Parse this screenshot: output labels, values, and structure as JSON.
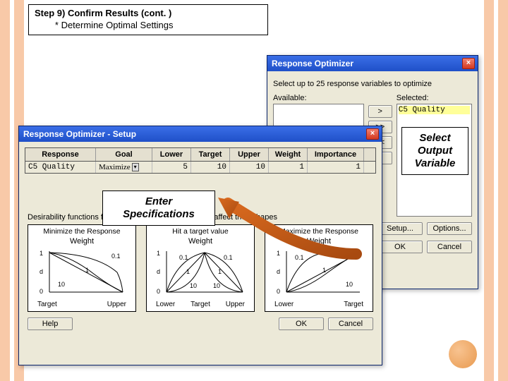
{
  "slide": {
    "title_line1": "Step 9) Confirm Results (cont. )",
    "title_line2": "        * Determine Optimal Settings"
  },
  "callouts": {
    "enter": "Enter Specifications",
    "select": "Select Output Variable"
  },
  "optimizer": {
    "title": "Response Optimizer",
    "hint": "Select up to 25 response variables to optimize",
    "available_label": "Available:",
    "selected_label": "Selected:",
    "selected_item": "C5   Quality",
    "move_right": ">",
    "move_all_right": ">>",
    "move_all_left": "<<",
    "move_left": "<",
    "setup_btn": "Setup...",
    "options_btn": "Options...",
    "ok_btn": "OK",
    "cancel_btn": "Cancel",
    "close_glyph": "×"
  },
  "setup": {
    "title": "Response Optimizer - Setup",
    "close_glyph": "×",
    "headers": {
      "response": "Response",
      "goal": "Goal",
      "lower": "Lower",
      "target": "Target",
      "upper": "Upper",
      "weight": "Weight",
      "importance": "Importance"
    },
    "row": {
      "response": "C5  Quality",
      "goal": "Maximize",
      "lower": "5",
      "target": "10",
      "upper": "10",
      "weight": "1",
      "importance": "1"
    },
    "desirability_label": "Desirability functions for different goals - how Weights affect their shapes",
    "plots": {
      "minimize": {
        "title": "Minimize the Response",
        "weight": "Weight",
        "x1": "Target",
        "x2": "Upper"
      },
      "target": {
        "title": "Hit a target value",
        "weight": "Weight",
        "x1": "Lower",
        "x2": "Target",
        "x3": "Upper"
      },
      "maximize": {
        "title": "Maximize the Response",
        "weight": "Weight",
        "x1": "Lower",
        "x2": "Target"
      }
    },
    "w_labels": {
      "a": "0.1",
      "b": "1",
      "c": "10"
    },
    "y_labels": {
      "top": "1",
      "mid": "d",
      "bot": "0"
    },
    "help_btn": "Help",
    "ok_btn": "OK",
    "cancel_btn": "Cancel"
  },
  "chart_data": [
    {
      "type": "line",
      "title": "Minimize the Response — Weight",
      "xlabel": "",
      "ylabel": "d",
      "x_ticks": [
        "Target",
        "Upper"
      ],
      "ylim": [
        0,
        1
      ],
      "series": [
        {
          "name": "0.1",
          "x": [
            0,
            0.2,
            0.5,
            0.8,
            1
          ],
          "values": [
            1,
            0.55,
            0.25,
            0.08,
            0
          ]
        },
        {
          "name": "1",
          "x": [
            0,
            1
          ],
          "values": [
            1,
            0
          ]
        },
        {
          "name": "10",
          "x": [
            0,
            0.2,
            0.5,
            0.8,
            1
          ],
          "values": [
            1,
            0.92,
            0.75,
            0.45,
            0
          ]
        }
      ]
    },
    {
      "type": "line",
      "title": "Hit a target value — Weight",
      "xlabel": "",
      "ylabel": "d",
      "x_ticks": [
        "Lower",
        "Target",
        "Upper"
      ],
      "ylim": [
        0,
        1
      ],
      "series": [
        {
          "name": "0.1",
          "x": [
            0,
            0.15,
            0.5,
            0.85,
            1
          ],
          "values": [
            0,
            0.7,
            1,
            0.7,
            0
          ]
        },
        {
          "name": "1",
          "x": [
            0,
            0.5,
            1
          ],
          "values": [
            0,
            1,
            0
          ]
        },
        {
          "name": "10",
          "x": [
            0,
            0.35,
            0.5,
            0.65,
            1
          ],
          "values": [
            0,
            0.1,
            1,
            0.1,
            0
          ]
        }
      ]
    },
    {
      "type": "line",
      "title": "Maximize the Response — Weight",
      "xlabel": "",
      "ylabel": "d",
      "x_ticks": [
        "Lower",
        "Target"
      ],
      "ylim": [
        0,
        1
      ],
      "series": [
        {
          "name": "0.1",
          "x": [
            0,
            0.2,
            0.5,
            0.8,
            1
          ],
          "values": [
            0,
            0.45,
            0.75,
            0.92,
            1
          ]
        },
        {
          "name": "1",
          "x": [
            0,
            1
          ],
          "values": [
            0,
            1
          ]
        },
        {
          "name": "10",
          "x": [
            0,
            0.2,
            0.5,
            0.8,
            1
          ],
          "values": [
            0,
            0.08,
            0.25,
            0.55,
            1
          ]
        }
      ]
    }
  ]
}
